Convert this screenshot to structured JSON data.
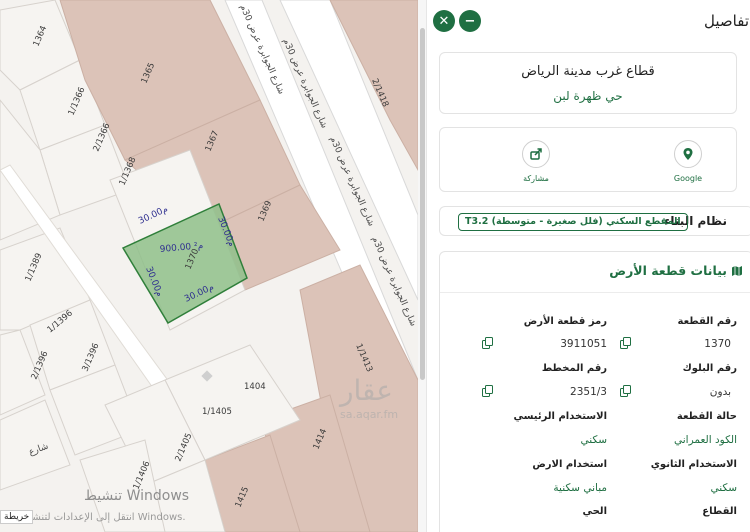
{
  "map": {
    "parcels": {
      "p1364": "1364",
      "p1365": "1365",
      "p1366": "1/1366",
      "p1366b": "2/1366",
      "p1367": "1367",
      "p1368": "1/1368",
      "p1369": "1369",
      "p1370": "1370",
      "p1389": "1/1389",
      "p1396a": "1/1396",
      "p1396b": "2/1396",
      "p1396c": "3/1396",
      "p1404": "1404",
      "p1405a": "1/1405",
      "p1405b": "2/1405",
      "p1406": "1/1406",
      "p1414": "1414",
      "p1415": "1415",
      "p1418": "2/1418",
      "p1413": "1/1413"
    },
    "streets": {
      "s1": "شارع الجوابرة عرض 30م",
      "s2": "شارع الجوابرة عرض 30م",
      "s3": "شارع الجوابرة عرض 30م",
      "s4": "شارع الجوابرة عرض 30م",
      "s5": "شارع"
    },
    "dimensions": {
      "area": "900.00 م²",
      "top": "30.00م",
      "right": "30.00م",
      "left": "30.00م",
      "bottom": "30.00م",
      "prev_parcel_top": "30.00م"
    },
    "watermark": {
      "brand": "عقار",
      "url": "sa.aqar.fm"
    },
    "left_label": "خريطة",
    "windows": {
      "line1": "تنشيط Windows",
      "line2": "انتقل إلى الإعدادات لتنشيط Windows."
    },
    "colors": {
      "parcel_fill": "#dcc3b8",
      "selected_fill": "#8fbf8a",
      "selected_stroke": "#2f7f3a",
      "road": "#ffffff"
    }
  },
  "panel": {
    "header_title": "تفاصيل",
    "close_symbol": "✕",
    "minimize_symbol": "−",
    "city_sector": "قطاع غرب مدينة الرياض",
    "district": "حي ظهرة لبن",
    "actions": [
      {
        "name": "google",
        "label": "Google",
        "icon": "map-pin-icon"
      },
      {
        "name": "share",
        "label": "مشاركة",
        "icon": "share-icon"
      }
    ],
    "building_system": {
      "label": "نظام البناء",
      "value": "T3.2 المقطع السكني (فلل صغيرة - متوسطة)"
    },
    "land_section": {
      "title": "بيانات قطعة الأرض",
      "icon": "map-icon",
      "fields": {
        "plot_number": {
          "label": "رقم القطعة",
          "value": "1370"
        },
        "plot_code": {
          "label": "رمز قطعة الأرض",
          "value": "3911051"
        },
        "block_number": {
          "label": "رقم البلوك",
          "value": "بدون"
        },
        "plan_number": {
          "label": "رقم المخطط",
          "value": "2351/3"
        },
        "plot_status": {
          "label": "حالة القطعة",
          "value": "الكود العمراني"
        },
        "main_use": {
          "label": "الاستخدام الرئيسي",
          "value": "سكني"
        },
        "secondary_use": {
          "label": "الاستخدام الثانوي",
          "value": "سكني"
        },
        "land_use": {
          "label": "استخدام الارض",
          "value": "مباني سكنية"
        },
        "sector": {
          "label": "القطاع",
          "value": ""
        },
        "district": {
          "label": "الحي",
          "value": ""
        }
      }
    },
    "colors": {
      "accent": "#1f6f42"
    }
  }
}
